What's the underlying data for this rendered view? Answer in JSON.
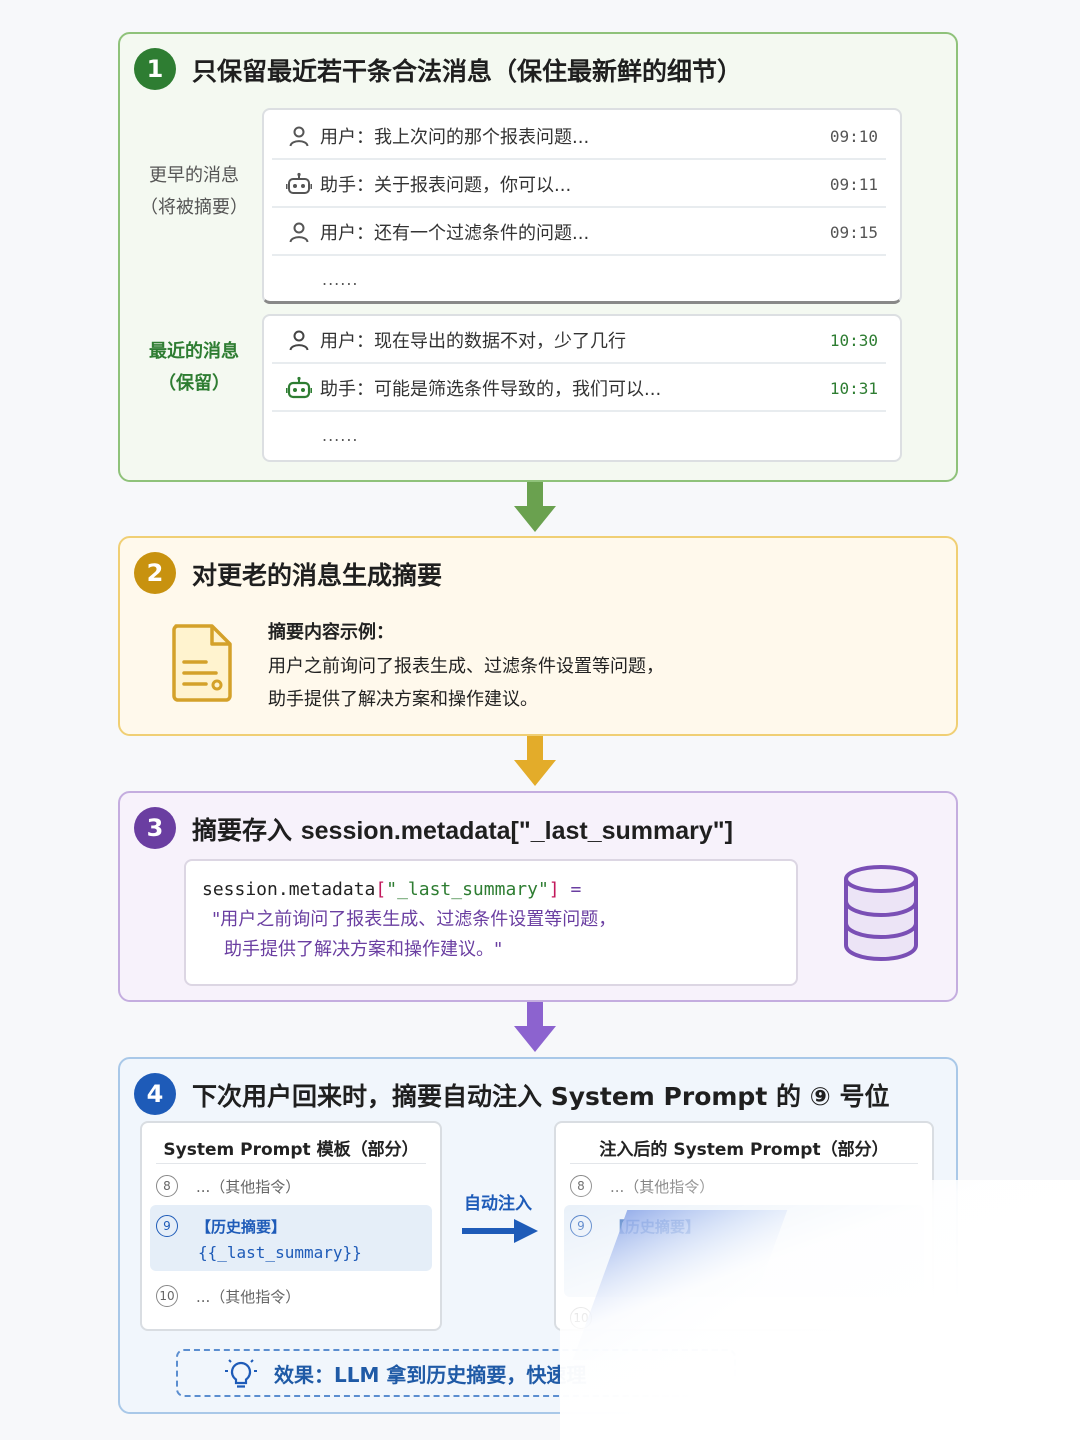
{
  "colors": {
    "green": "#2e7d32",
    "amber": "#c8920f",
    "purple": "#6a3ea1",
    "blue": "#1e5bb8"
  },
  "step1": {
    "number": "1",
    "title": "只保留最近若干条合法消息（保住最新鲜的细节）",
    "older_label_line1": "更早的消息",
    "older_label_line2": "（将被摘要）",
    "recent_label_line1": "最近的消息",
    "recent_label_line2": "（保留）",
    "older_messages": [
      {
        "role_icon": "user-icon",
        "text": "用户：我上次问的那个报表问题...",
        "time": "09:10"
      },
      {
        "role_icon": "robot-icon",
        "text": "助手：关于报表问题，你可以...",
        "time": "09:11"
      },
      {
        "role_icon": "user-icon",
        "text": "用户：还有一个过滤条件的问题...",
        "time": "09:15"
      }
    ],
    "older_ellipsis": "......",
    "recent_messages": [
      {
        "role_icon": "user-icon",
        "text": "用户：现在导出的数据不对，少了几行",
        "time": "10:30"
      },
      {
        "role_icon": "robot-icon",
        "text": "助手：可能是筛选条件导致的，我们可以...",
        "time": "10:31"
      }
    ],
    "recent_ellipsis": "......"
  },
  "step2": {
    "number": "2",
    "title": "对更老的消息生成摘要",
    "icon": "document-icon",
    "example_heading": "摘要内容示例：",
    "example_line1": "用户之前询问了报表生成、过滤条件设置等问题，",
    "example_line2": "助手提供了解决方案和操作建议。"
  },
  "step3": {
    "number": "3",
    "title_cn": "摘要存入",
    "title_code": "session.metadata[\"_last_summary\"]",
    "code_obj": "session.metadata",
    "code_bracket_open": "[",
    "code_key": "\"_last_summary\"",
    "code_bracket_close": "]",
    "code_eq": " =",
    "code_value_line1": "\"用户之前询问了报表生成、过滤条件设置等问题，",
    "code_value_line2": "助手提供了解决方案和操作建议。\"",
    "icon": "database-icon"
  },
  "step4": {
    "number": "4",
    "title": "下次用户回来时，摘要自动注入 System Prompt 的 ⑨ 号位",
    "template_title": "System Prompt 模板（部分）",
    "injected_title": "注入后的 System Prompt（部分）",
    "slot8_num": "8",
    "slot9_num": "9",
    "slot10_num": "10",
    "other_instr": "...（其他指令）",
    "history_label": "【历史摘要】",
    "history_var": "{{_last_summary}}",
    "history_label_injected": "【历史摘要】",
    "inject_label": "自动注入",
    "effect_text": "效果：LLM 拿到历史摘要，快速理"
  }
}
